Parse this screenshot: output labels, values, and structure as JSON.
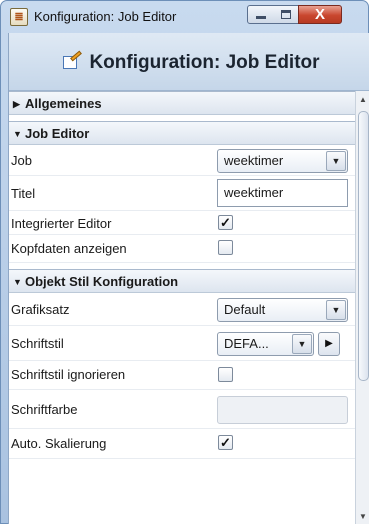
{
  "window": {
    "title": "Konfiguration: Job Editor",
    "close_glyph": "X"
  },
  "header": {
    "title": "Konfiguration: Job Editor",
    "icon": "edit-document-icon"
  },
  "sections": {
    "allgemeines": {
      "label": "Allgemeines",
      "expanded": false,
      "toggle_glyph": "▶"
    },
    "job_editor": {
      "label": "Job Editor",
      "expanded": true,
      "toggle_glyph": "▼",
      "job": {
        "label": "Job",
        "value": "weektimer"
      },
      "titel": {
        "label": "Titel",
        "value": "weektimer"
      },
      "integrierter_editor": {
        "label": "Integrierter Editor",
        "checked": true,
        "mark": "✓"
      },
      "kopfdaten": {
        "label": "Kopfdaten anzeigen",
        "checked": false,
        "mark": ""
      }
    },
    "objekt_stil": {
      "label": "Objekt Stil Konfiguration",
      "expanded": true,
      "toggle_glyph": "▼",
      "grafiksatz": {
        "label": "Grafiksatz",
        "value": "Default"
      },
      "schriftstil": {
        "label": "Schriftstil",
        "value": "DEFA..."
      },
      "schriftstil_ignorieren": {
        "label": "Schriftstil ignorieren",
        "checked": false,
        "mark": ""
      },
      "schriftfarbe": {
        "label": "Schriftfarbe",
        "value": ""
      },
      "auto_skalierung": {
        "label": "Auto. Skalierung",
        "checked": true,
        "mark": "✓"
      }
    }
  },
  "glyphs": {
    "dropdown": "▼",
    "play": "▶",
    "scroll_up": "▲",
    "scroll_down": "▼"
  },
  "colors": {
    "close_button": "#c9472f",
    "title_gradient_top": "#c8daef",
    "header_gradient": "#dfe9f4"
  }
}
